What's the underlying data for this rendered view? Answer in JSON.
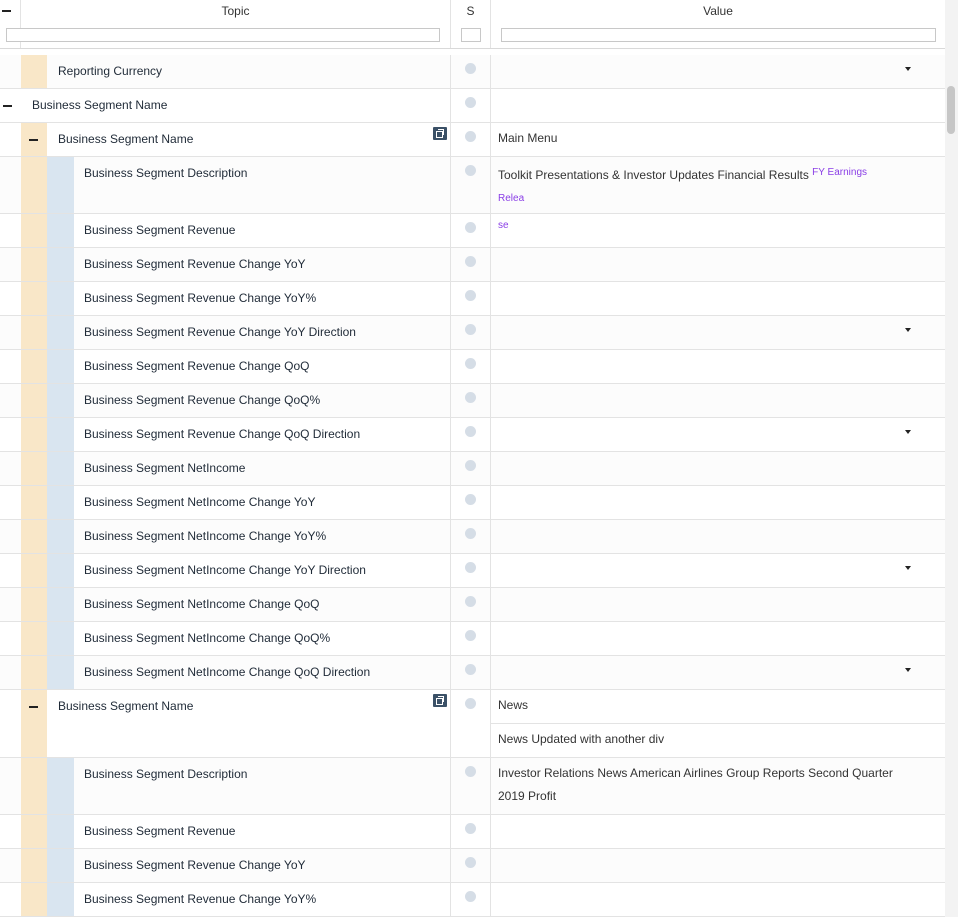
{
  "header": {
    "topic_label": "Topic",
    "status_label": "S",
    "value_label": "Value"
  },
  "row_reporting": {
    "topic": "Reporting Currency"
  },
  "row_segment_group": {
    "topic": "Business Segment Name"
  },
  "block1": {
    "name_row": {
      "topic": "Business Segment Name",
      "value": "Main Menu"
    },
    "desc_row": {
      "topic": "Business Segment Description",
      "value": "Toolkit Presentations & Investor Updates Financial Results",
      "link": "FY Earnings Relea",
      "link_wrap": "se"
    },
    "rows": [
      {
        "topic": "Business Segment Revenue"
      },
      {
        "topic": "Business Segment Revenue Change YoY"
      },
      {
        "topic": "Business Segment Revenue Change YoY%"
      },
      {
        "topic": "Business Segment Revenue Change YoY Direction"
      },
      {
        "topic": "Business Segment Revenue Change QoQ"
      },
      {
        "topic": "Business Segment Revenue Change QoQ%"
      },
      {
        "topic": "Business Segment Revenue Change QoQ Direction"
      },
      {
        "topic": "Business Segment NetIncome"
      },
      {
        "topic": "Business Segment NetIncome Change YoY"
      },
      {
        "topic": "Business Segment NetIncome Change YoY%"
      },
      {
        "topic": "Business Segment NetIncome Change YoY Direction"
      },
      {
        "topic": "Business Segment NetIncome Change QoQ"
      },
      {
        "topic": "Business Segment NetIncome Change QoQ%"
      },
      {
        "topic": "Business Segment NetIncome Change QoQ Direction"
      }
    ]
  },
  "block2": {
    "name_row": {
      "topic": "Business Segment Name",
      "value": "News",
      "value2": "News Updated with another div"
    },
    "desc_row": {
      "topic": "Business Segment Description",
      "value": "Investor Relations News American Airlines Group Reports Second Quarter",
      "value_wrap": "2019 Profit"
    },
    "rows": [
      {
        "topic": "Business Segment Revenue"
      },
      {
        "topic": "Business Segment Revenue Change YoY"
      },
      {
        "topic": "Business Segment Revenue Change YoY%"
      }
    ]
  }
}
